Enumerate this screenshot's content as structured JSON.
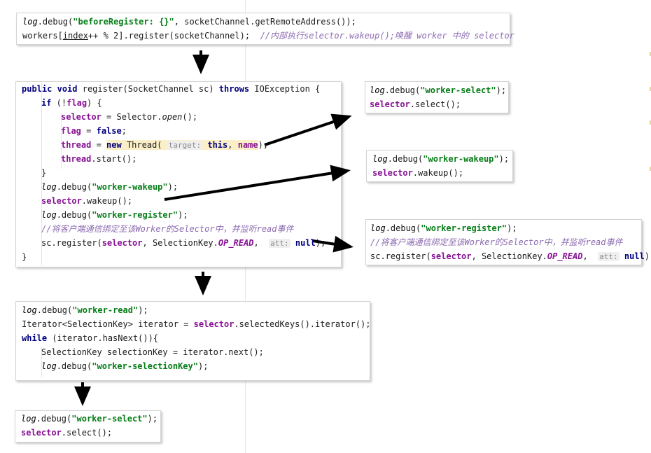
{
  "snippets": {
    "top": {
      "line1": {
        "log": "log",
        "call": ".debug(",
        "str": "\"beforeRegister: {}\"",
        "rest": ", socketChannel.getRemoteAddress());"
      },
      "line2": {
        "a": "workers[",
        "idx": "index",
        "b": "++ % 2].register(socketChannel);  ",
        "comment": "//内部执行selector.wakeup();唤醒 worker 中的 selector"
      }
    },
    "register": {
      "l1": {
        "kw1": "public",
        "kw2": "void",
        "sig": " register(SocketChannel sc) ",
        "kw3": "throws",
        "exc": " IOException {"
      },
      "l2": {
        "kw": "if",
        "cond": " (!",
        "fld": "flag",
        "end": ") {"
      },
      "l3": {
        "fld": "selector",
        "mid": " = Selector.",
        "m": "open",
        "end": "();"
      },
      "l4": {
        "fld": "flag",
        "mid": " = ",
        "kw": "false",
        "end": ";"
      },
      "l5": {
        "fld": "thread",
        "mid": " = ",
        "kw": "new",
        "cls": " Thread(",
        "hint": "target:",
        "kw2": "this",
        "sep": ", ",
        "fld2": "name",
        "end": ");"
      },
      "l6": {
        "fld": "thread",
        "end": ".start();"
      },
      "l7": {
        "text": "}"
      },
      "l8": {
        "log": "log",
        "call": ".debug(",
        "str": "\"worker-wakeup\"",
        "end": ");"
      },
      "l9": {
        "fld": "selector",
        "end": ".wakeup();"
      },
      "l10": {
        "log": "log",
        "call": ".debug(",
        "str": "\"worker-register\"",
        "end": ");"
      },
      "l11": {
        "comment": "//将客户端通信绑定至该Worker的Selector中，并监听read事件"
      },
      "l12": {
        "a": "sc.register(",
        "fld": "selector",
        "b": ", SelectionKey.",
        "cst": "OP_READ",
        "c": ",  ",
        "hint": "att:",
        "kw": "null",
        "end": ");"
      },
      "l13": {
        "text": "}"
      }
    },
    "select_right": {
      "l1": {
        "log": "log",
        "call": ".debug(",
        "str": "\"worker-select\"",
        "end": ");"
      },
      "l2": {
        "fld": "selector",
        "end": ".select();"
      }
    },
    "wakeup_right": {
      "l1": {
        "log": "log",
        "call": ".debug(",
        "str": "\"worker-wakeup\"",
        "end": ");"
      },
      "l2": {
        "fld": "selector",
        "end": ".wakeup();"
      }
    },
    "register_right": {
      "l1": {
        "log": "log",
        "call": ".debug(",
        "str": "\"worker-register\"",
        "end": ");"
      },
      "l2": {
        "comment": "//将客户端通信绑定至该Worker的Selector中，并监听read事件"
      },
      "l3": {
        "a": "sc.register(",
        "fld": "selector",
        "b": ", SelectionKey.",
        "cst": "OP_READ",
        "c": ",  ",
        "hint": "att:",
        "kw": "null",
        "end": ");"
      }
    },
    "read": {
      "l1": {
        "log": "log",
        "call": ".debug(",
        "str": "\"worker-read\"",
        "end": ");"
      },
      "l2": {
        "a": "Iterator<SelectionKey> iterator = ",
        "fld": "selector",
        "end": ".selectedKeys().iterator();"
      },
      "l3": {
        "kw": "while",
        "end": " (iterator.hasNext()){"
      },
      "l4": {
        "text": "SelectionKey selectionKey = iterator.next();"
      },
      "l5": {
        "log": "log",
        "call": ".debug(",
        "str": "\"worker-selectionKey\"",
        "end": ");"
      }
    },
    "select_bottom": {
      "l1": {
        "log": "log",
        "call": ".debug(",
        "str": "\"worker-select\"",
        "end": ");"
      },
      "l2": {
        "fld": "selector",
        "end": ".select();"
      }
    }
  },
  "colors": {
    "keyword": "#000080",
    "string": "#067d17",
    "field": "#871094",
    "comment": "#8c6bb1",
    "arrow": "#000000"
  }
}
